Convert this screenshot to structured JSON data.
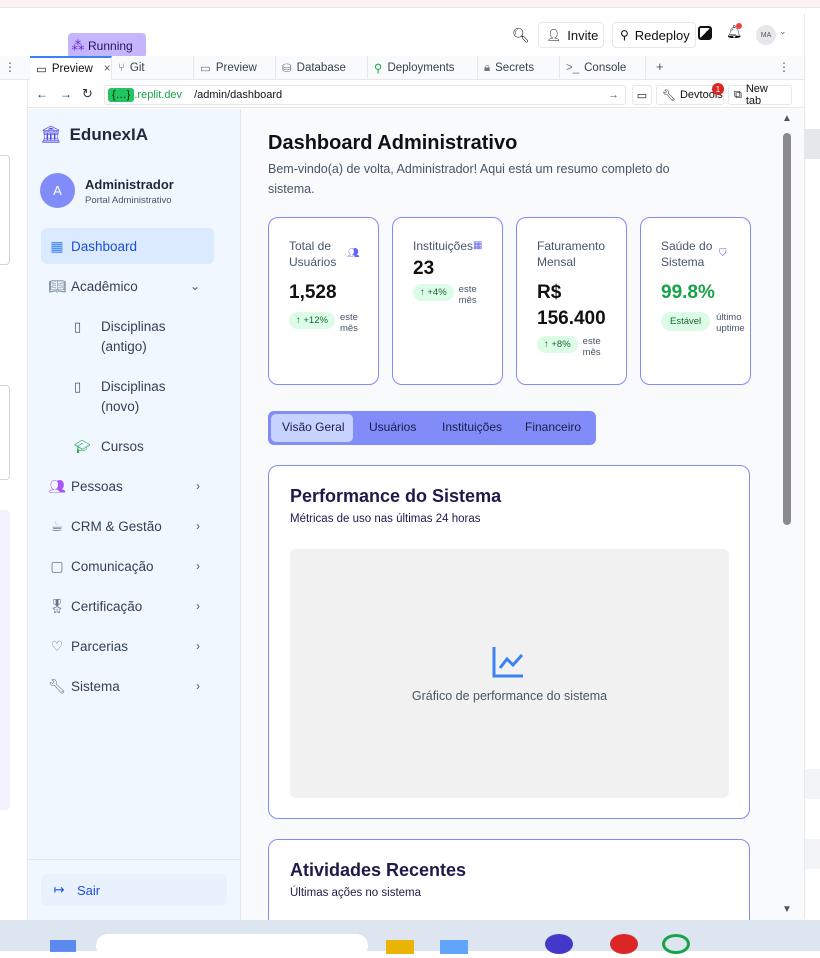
{
  "toolbar": {
    "running": "Running",
    "invite": "Invite",
    "redeploy": "Redeploy",
    "avatar_initials": "MA"
  },
  "tabs": [
    {
      "label": "Preview",
      "close": "×"
    },
    {
      "label": "Git"
    },
    {
      "label": "Preview"
    },
    {
      "label": "Database"
    },
    {
      "label": "Deployments"
    },
    {
      "label": "Secrets"
    },
    {
      "label": "Console"
    },
    {
      "label": "+"
    }
  ],
  "urlbar": {
    "host": ".replit.dev",
    "path": "/admin/dashboard",
    "devtools": "Devtools",
    "devtools_badge": "1",
    "new_tab": "New tab"
  },
  "sidebar": {
    "brand": "EdunexIA",
    "user": {
      "initial": "A",
      "name": "Administrador",
      "role": "Portal Administrativo"
    },
    "items": [
      {
        "label": "Dashboard",
        "icon": "grid-icon"
      },
      {
        "label": "Acadêmico",
        "icon": "book-open-icon"
      },
      {
        "label": "Pessoas",
        "icon": "users-icon"
      },
      {
        "label": "CRM & Gestão",
        "icon": "coffee-icon"
      },
      {
        "label": "Comunicação",
        "icon": "message-icon"
      },
      {
        "label": "Certificação",
        "icon": "award-icon"
      },
      {
        "label": "Parcerias",
        "icon": "heart-icon"
      },
      {
        "label": "Sistema",
        "icon": "wrench-icon"
      }
    ],
    "subitems": [
      {
        "label1": "Disciplinas",
        "label2": "(antigo)"
      },
      {
        "label1": "Disciplinas",
        "label2": "(novo)"
      },
      {
        "label1": "Cursos",
        "label2": ""
      }
    ],
    "logout": "Sair"
  },
  "main": {
    "title": "Dashboard Administrativo",
    "subtitle1": "Bem-vindo(a) de volta, Administrador! Aqui está um resumo completo do",
    "subtitle2": "sistema.",
    "cards": [
      {
        "label1": "Total de",
        "label2": "Usuários",
        "value": "1,528",
        "value2": "",
        "badge": "↑ +12%",
        "note1": "este",
        "note2": "mês"
      },
      {
        "label1": "Instituições",
        "label2": "",
        "value": "23",
        "value2": "",
        "badge": "↑ +4%",
        "note1": "este",
        "note2": "mês"
      },
      {
        "label1": "Faturamento",
        "label2": "Mensal",
        "value": "R$",
        "value2": "156.400",
        "badge": "↑ +8%",
        "note1": "este",
        "note2": "mês"
      },
      {
        "label1": "Saúde do",
        "label2": "Sistema",
        "value": "99.8%",
        "value2": "",
        "badge": "Estável",
        "note1": "último",
        "note2": "uptime"
      }
    ],
    "tabs": [
      "Visão Geral",
      "Usuários",
      "Instituições",
      "Financeiro"
    ],
    "performance": {
      "title": "Performance do Sistema",
      "subtitle": "Métricas de uso nas últimas 24 horas",
      "placeholder": "Gráfico de performance do sistema"
    },
    "activities": {
      "title": "Atividades Recentes",
      "subtitle": "Últimas ações no sistema"
    }
  },
  "colors": {
    "accent": "#818cf8",
    "active_nav": "#dbeafe",
    "success": "#16a34a",
    "running": "#c4b5fd"
  }
}
